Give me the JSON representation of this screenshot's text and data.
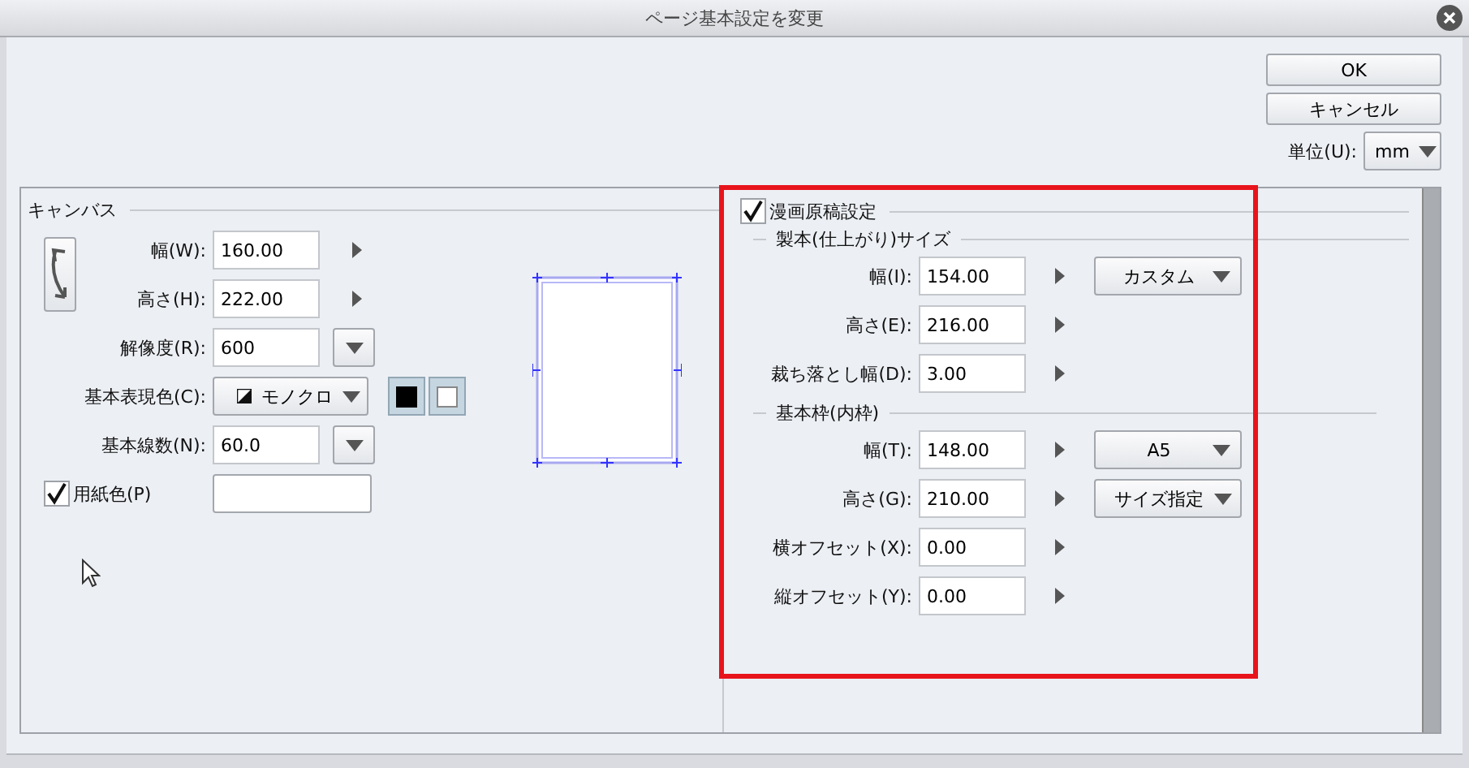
{
  "title": "ページ基本設定を変更",
  "buttons": [
    "OK",
    "キャンセル"
  ],
  "unit": {
    "label": "単位(U):",
    "value": "mm"
  },
  "canvas": {
    "title": "キャンバス",
    "fields": [
      {
        "kind": "arrow",
        "label": "幅(W):",
        "value": "160.00"
      },
      {
        "kind": "arrow",
        "label": "高さ(H):",
        "value": "222.00"
      },
      {
        "kind": "menu",
        "label": "解像度(R):",
        "value": "600"
      },
      {
        "kind": "colormode",
        "label": "基本表現色(C):",
        "value": "モノクロ"
      },
      {
        "kind": "menu",
        "label": "基本線数(N):",
        "value": "60.0"
      },
      {
        "kind": "checkcolor",
        "label": "用紙色(P)",
        "checked": true
      }
    ]
  },
  "manga": {
    "title": "漫画原稿設定",
    "checked": true,
    "sections": [
      {
        "title": "製本(仕上がり)サイズ",
        "fields": [
          {
            "label": "幅(I):",
            "value": "154.00",
            "preset": "カスタム"
          },
          {
            "label": "高さ(E):",
            "value": "216.00"
          },
          {
            "label": "裁ち落とし幅(D):",
            "value": "3.00"
          }
        ]
      },
      {
        "title": "基本枠(内枠)",
        "fields": [
          {
            "label": "幅(T):",
            "value": "148.00",
            "preset": "A5"
          },
          {
            "label": "高さ(G):",
            "value": "210.00",
            "preset": "サイズ指定"
          },
          {
            "label": "横オフセット(X):",
            "value": "0.00"
          },
          {
            "label": "縦オフセット(Y):",
            "value": "0.00"
          }
        ]
      }
    ]
  }
}
